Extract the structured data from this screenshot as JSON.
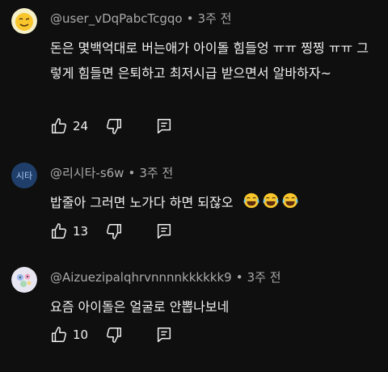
{
  "comments": [
    {
      "author": "@user_vDqPabcTcgqo",
      "time": "3주 전",
      "text": "돈은 몇백억대로 버는애가 아이돌 힘들엉 ㅠㅠ 찡찡 ㅠㅠ  그렇게 힘들면 은퇴하고 최저시급 받으면서 알바하자~",
      "likes": "24",
      "avatar_icon": "winking-face-avatar"
    },
    {
      "author": "@리시타-s6w",
      "time": "3주 전",
      "text": "밥줄아 그러면 노가다 하면 되잖오",
      "likes": "13",
      "avatar_text": "시타",
      "avatar_color": "#1f3f6a",
      "emojis": [
        "face-with-tears-of-joy-icon",
        "face-with-tears-of-joy-icon",
        "face-with-tears-of-joy-icon"
      ]
    },
    {
      "author": "@Aizuezipalqhrvnnnnkkkkkk9",
      "time": "3주 전",
      "text": "요즘 아이돌은 얼굴로 안뽑나보네",
      "likes": "10",
      "avatar_icon": "pastel-blob-avatar"
    }
  ],
  "separator": "•",
  "colors": {
    "background": "#0f0f0f",
    "text": "#f1f1f1",
    "meta": "#aaaaaa"
  }
}
